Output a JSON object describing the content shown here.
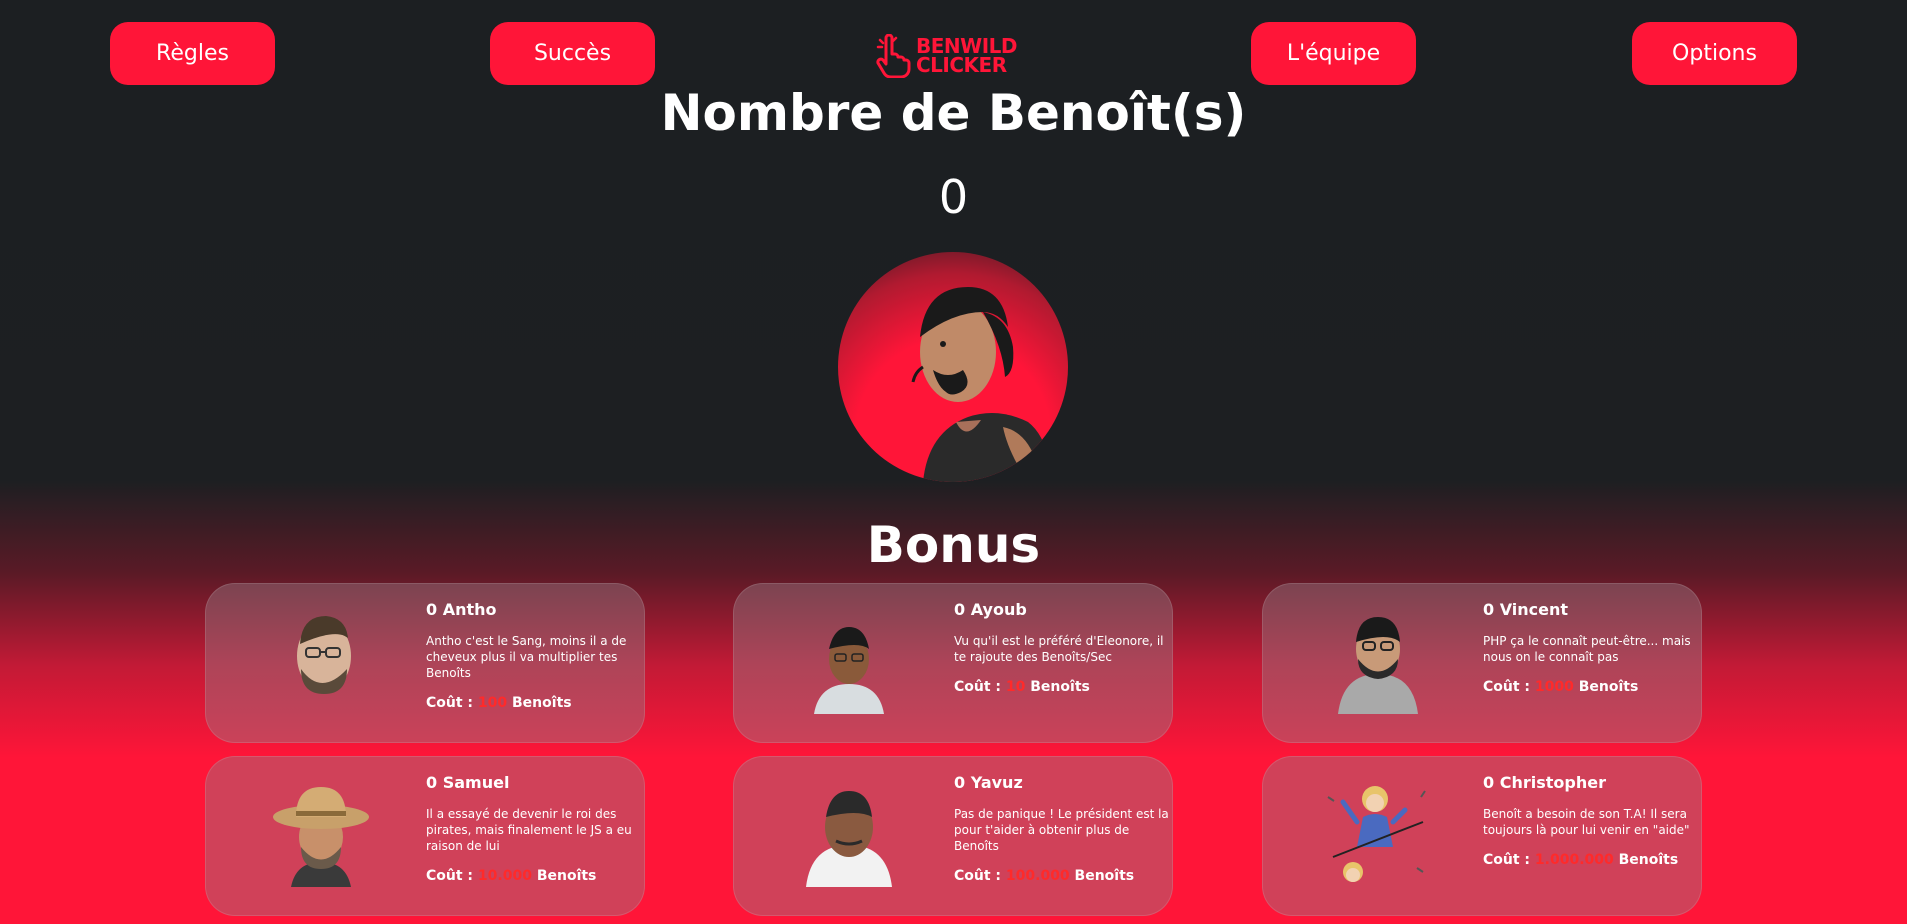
{
  "nav": {
    "rules": "Règles",
    "success": "Succès",
    "team": "L'équipe",
    "options": "Options"
  },
  "logo": {
    "line1": "BENWILD",
    "line2": "CLICKER"
  },
  "main": {
    "title": "Nombre de Benoît(s)",
    "count": "0"
  },
  "bonus": {
    "title": "Bonus",
    "cost_label": "Coût :",
    "cost_unit": "Benoîts",
    "cards": [
      {
        "name": "0 Antho",
        "desc": "Antho c'est le Sang, moins il a de cheveux plus il va multiplier tes Benoîts",
        "cost": "100"
      },
      {
        "name": "0 Ayoub",
        "desc": "Vu qu'il est le préféré d'Eleonore, il te rajoute des Benoîts/Sec",
        "cost": "10"
      },
      {
        "name": "0 Vincent",
        "desc": "PHP ça le connaît peut-être... mais nous on le connaît pas",
        "cost": "1000"
      },
      {
        "name": "0 Samuel",
        "desc": "Il a essayé de devenir le roi des pirates, mais finalement le JS a eu raison de lui",
        "cost": "10.000"
      },
      {
        "name": "0 Yavuz",
        "desc": "Pas de panique ! Le président est la pour t'aider à obtenir plus de Benoîts",
        "cost": "100.000"
      },
      {
        "name": "0 Christopher",
        "desc": "Benoît a besoin de son T.A! Il sera toujours là pour lui venir en \"aide\"",
        "cost": "1.000.000"
      }
    ]
  },
  "colors": {
    "accent": "#ff1538",
    "background": "#1d1f22",
    "cost": "#ff2a2a"
  }
}
